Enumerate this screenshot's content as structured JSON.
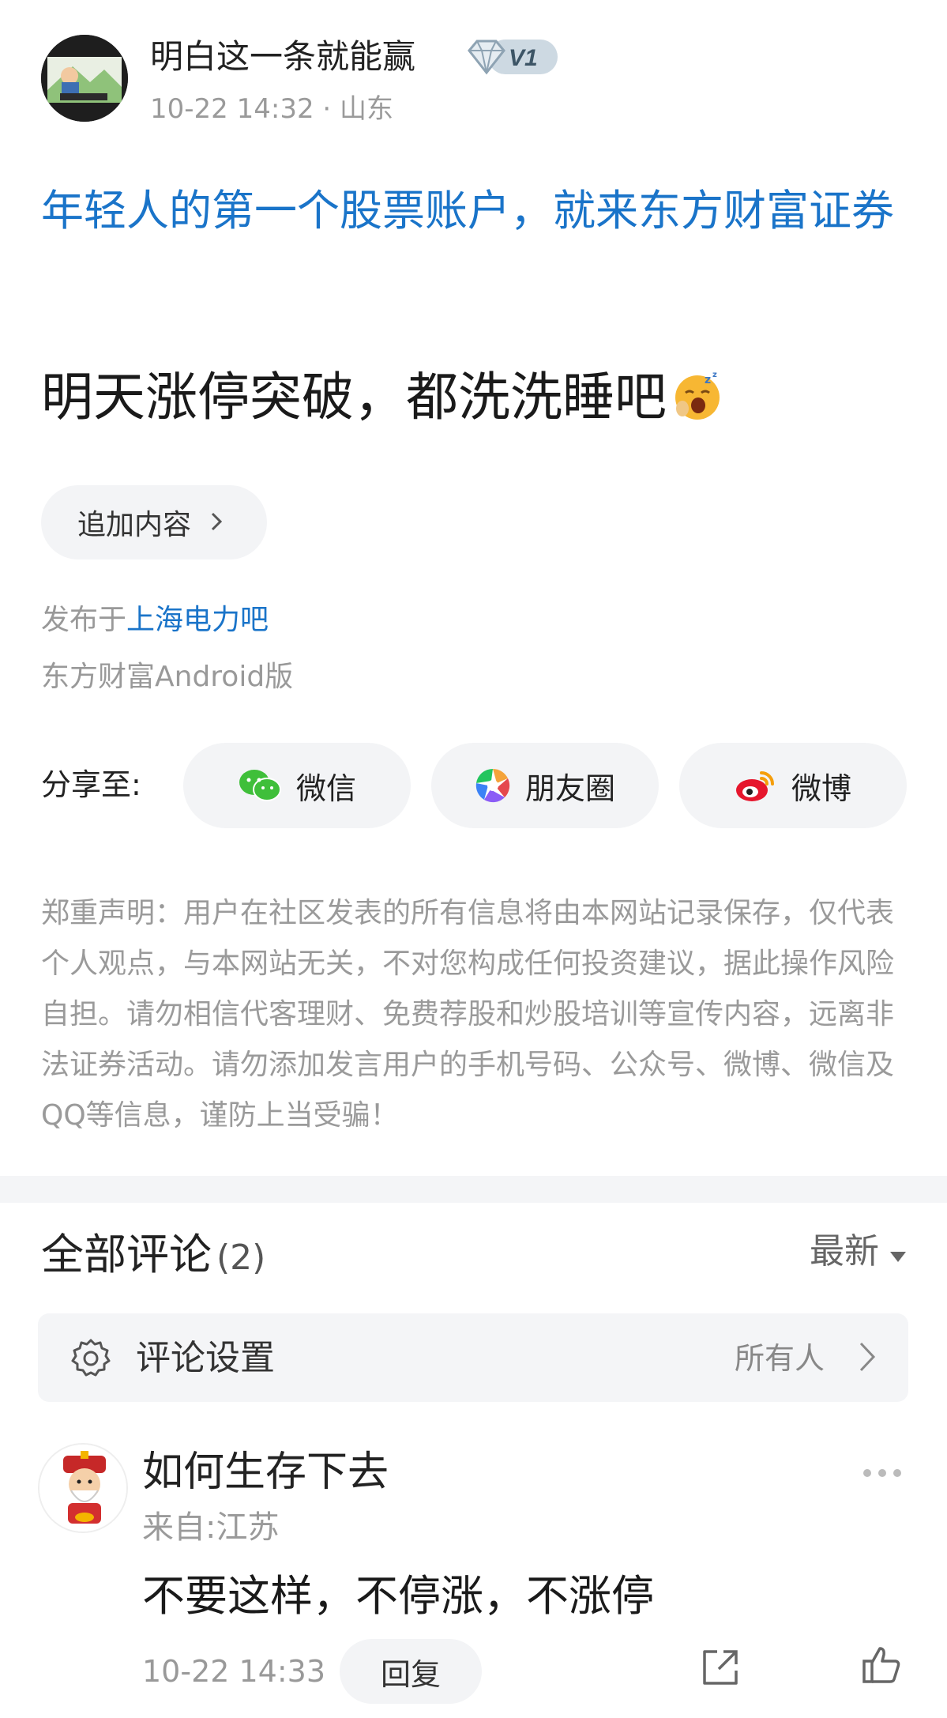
{
  "post": {
    "author_name": "明白这一条就能赢",
    "level": "V1",
    "meta": "10-22 14:32 · 山东",
    "title": "年轻人的第一个股票账户，就来东方财富证券",
    "body": "明天涨停突破，都洗洗睡吧",
    "add_content_label": "追加内容",
    "published_prefix": "发布于",
    "published_bar": "上海电力吧",
    "client": "东方财富Android版"
  },
  "share": {
    "label": "分享至:",
    "buttons": [
      {
        "label": "微信",
        "icon": "wechat-icon",
        "color": "#3fbf3a"
      },
      {
        "label": "朋友圈",
        "icon": "moments-icon",
        "color": "#f4a33a"
      },
      {
        "label": "微博",
        "icon": "weibo-icon",
        "color": "#e6162d"
      }
    ]
  },
  "disclaimer": "郑重声明：用户在社区发表的所有信息将由本网站记录保存，仅代表个人观点，与本网站无关，不对您构成任何投资建议，据此操作风险自担。请勿相信代客理财、免费荐股和炒股培训等宣传内容，远离非法证券活动。请勿添加发言用户的手机号码、公众号、微博、微信及QQ等信息，谨防上当受骗！",
  "comments": {
    "title": "全部评论",
    "count": "(2)",
    "sort_label": "最新",
    "settings_label": "评论设置",
    "settings_value": "所有人",
    "items": [
      {
        "name": "如何生存下去",
        "location": "来自:江苏",
        "text": "不要这样，不停涨，不涨停",
        "time": "10-22 14:33",
        "reply_label": "回复"
      }
    ]
  },
  "colors": {
    "link": "#1a74c9",
    "muted": "#9a9a9a",
    "pill_bg": "#f3f4f6"
  }
}
